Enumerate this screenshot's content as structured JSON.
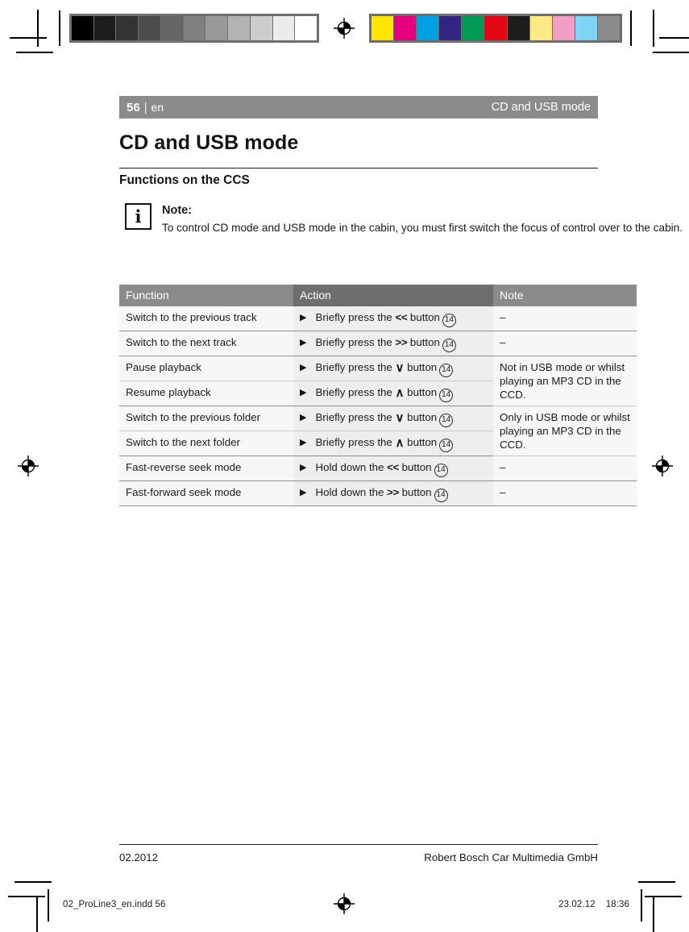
{
  "runhead": {
    "page_number": "56",
    "separator": "|",
    "language": "en",
    "chapter_right": "CD and USB mode"
  },
  "chapter_title": "CD and USB mode",
  "section_title": "Functions on the CCS",
  "note": {
    "icon": "info-icon",
    "glyph": "i",
    "title": "Note:",
    "text": "To control CD mode and USB mode in the cabin, you must first switch the focus of control over to the cabin."
  },
  "table": {
    "headers": [
      "Function",
      "Action",
      "Note"
    ],
    "rows": [
      {
        "function": "Switch to the previous track",
        "action_pre": "Briefly press the",
        "action_key": "<<",
        "action_key_type": "bold",
        "action_post": "button",
        "ref": "14",
        "note": "–",
        "note_rowspan": 1,
        "group_end": true
      },
      {
        "function": "Switch to the next track",
        "action_pre": "Briefly press the",
        "action_key": ">>",
        "action_key_type": "bold",
        "action_post": "button",
        "ref": "14",
        "note": "–",
        "note_rowspan": 1,
        "group_end": true
      },
      {
        "function": "Pause playback",
        "action_pre": "Briefly press the",
        "action_key": "∨",
        "action_key_type": "chevron",
        "action_post": "button",
        "ref": "14",
        "note": "Not in USB mode or whilst playing an MP3 CD in the CCD.",
        "note_rowspan": 2,
        "group_end": false
      },
      {
        "function": "Resume playback",
        "action_pre": "Briefly press the",
        "action_key": "∧",
        "action_key_type": "chevron",
        "action_post": "button",
        "ref": "14",
        "note": null,
        "note_rowspan": 0,
        "group_end": true
      },
      {
        "function": "Switch to the previous folder",
        "action_pre": "Briefly press the",
        "action_key": "∨",
        "action_key_type": "chevron",
        "action_post": "button",
        "ref": "14",
        "note": "Only in USB mode or whilst playing an MP3 CD in the CCD.",
        "note_rowspan": 2,
        "group_end": false
      },
      {
        "function": "Switch to the next folder",
        "action_pre": "Briefly press the",
        "action_key": "∧",
        "action_key_type": "chevron",
        "action_post": "button",
        "ref": "14",
        "note": null,
        "note_rowspan": 0,
        "group_end": true
      },
      {
        "function": "Fast-reverse seek mode",
        "action_pre": "Hold down the",
        "action_key": "<<",
        "action_key_type": "bold",
        "action_post": "button",
        "ref": "14",
        "note": "–",
        "note_rowspan": 1,
        "group_end": true
      },
      {
        "function": "Fast-forward seek mode",
        "action_pre": "Hold down the",
        "action_key": ">>",
        "action_key_type": "bold",
        "action_post": "button",
        "ref": "14",
        "note": "–",
        "note_rowspan": 1,
        "group_end": true
      }
    ]
  },
  "footer": {
    "date": "02.2012",
    "company": "Robert Bosch Car Multimedia GmbH"
  },
  "slug": {
    "file": "02_ProLine3_en.indd   56",
    "date": "23.02.12",
    "time": "18:36",
    "mark": "registration-mark"
  },
  "calibration": {
    "grayscale": [
      "#000000",
      "#1d1d1d",
      "#333333",
      "#4c4c4c",
      "#666666",
      "#808080",
      "#999999",
      "#b3b3b3",
      "#cccccc",
      "#ececec",
      "#ffffff"
    ],
    "color": [
      "#ffe600",
      "#e6007e",
      "#00a0e3",
      "#312783",
      "#009b55",
      "#e30613",
      "#1d1d1b",
      "#fbea86",
      "#f29ec4",
      "#7fd3f5",
      "#8c8c8c"
    ]
  },
  "colors": {
    "runhead_bg": "#8b8b8b",
    "header_dark": "#6e6e6e",
    "row_light": "#f7f7f7",
    "row_mid": "#eeeeee",
    "text": "#1a1a1a"
  }
}
